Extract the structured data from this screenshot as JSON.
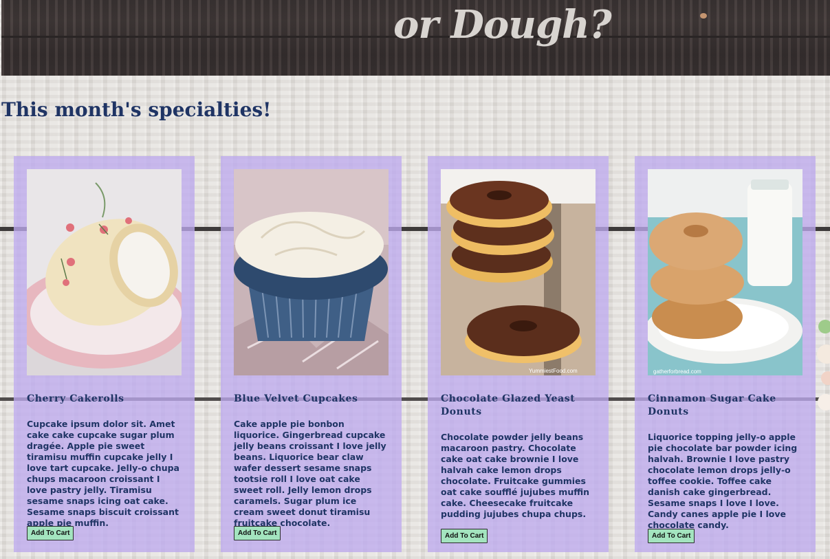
{
  "header": {
    "title": "or Dough?"
  },
  "specials": {
    "title": "This month's specialties!",
    "items": [
      {
        "name": "Cherry Cakerolls",
        "image_icon": "cherry-cakeroll-photo",
        "description": "Cupcake ipsum dolor sit. Amet cake cake cupcake sugar plum dragée. Apple pie sweet tiramisu muffin cupcake jelly I love tart cupcake. Jelly-o chupa chups macaroon croissant I love pastry jelly. Tiramisu sesame snaps icing oat cake. Sesame snaps biscuit croissant apple pie muffin.",
        "button_label": "Add To Cart"
      },
      {
        "name": "Blue Velvet Cupcakes",
        "image_icon": "blue-velvet-cupcake-photo",
        "description": "Cake apple pie bonbon liquorice. Gingerbread cupcake jelly beans croissant I love jelly beans. Liquorice bear claw wafer dessert sesame snaps tootsie roll I love oat cake sweet roll. Jelly lemon drops caramels. Sugar plum ice cream sweet donut tiramisu fruitcake chocolate.",
        "button_label": "Add To Cart"
      },
      {
        "name": "Chocolate Glazed Yeast Donuts",
        "image_icon": "chocolate-donuts-photo",
        "image_watermark": "YummiestFood.com",
        "description": "Chocolate powder jelly beans macaroon pastry. Chocolate cake oat cake brownie I love halvah cake lemon drops chocolate. Fruitcake gummies oat cake soufflé jujubes muffin cake. Cheesecake fruitcake pudding jujubes chupa chups.",
        "button_label": "Add To Cart"
      },
      {
        "name": "Cinnamon Sugar Cake Donuts",
        "image_icon": "cinnamon-donuts-photo",
        "image_watermark": "gatherforbread.com",
        "description": "Liquorice topping jelly-o apple pie chocolate bar powder icing halvah. Brownie I love pastry chocolate lemon drops jelly-o toffee cookie. Toffee cake danish cake gingerbread. Sesame snaps I love I love. Candy canes apple pie I love chocolate candy.",
        "button_label": "Add To Cart"
      }
    ]
  },
  "colors": {
    "card_background": "#beaaee",
    "title_text": "#1f3464",
    "button_background": "#a3e4bf",
    "header_background": "#3b3535"
  }
}
